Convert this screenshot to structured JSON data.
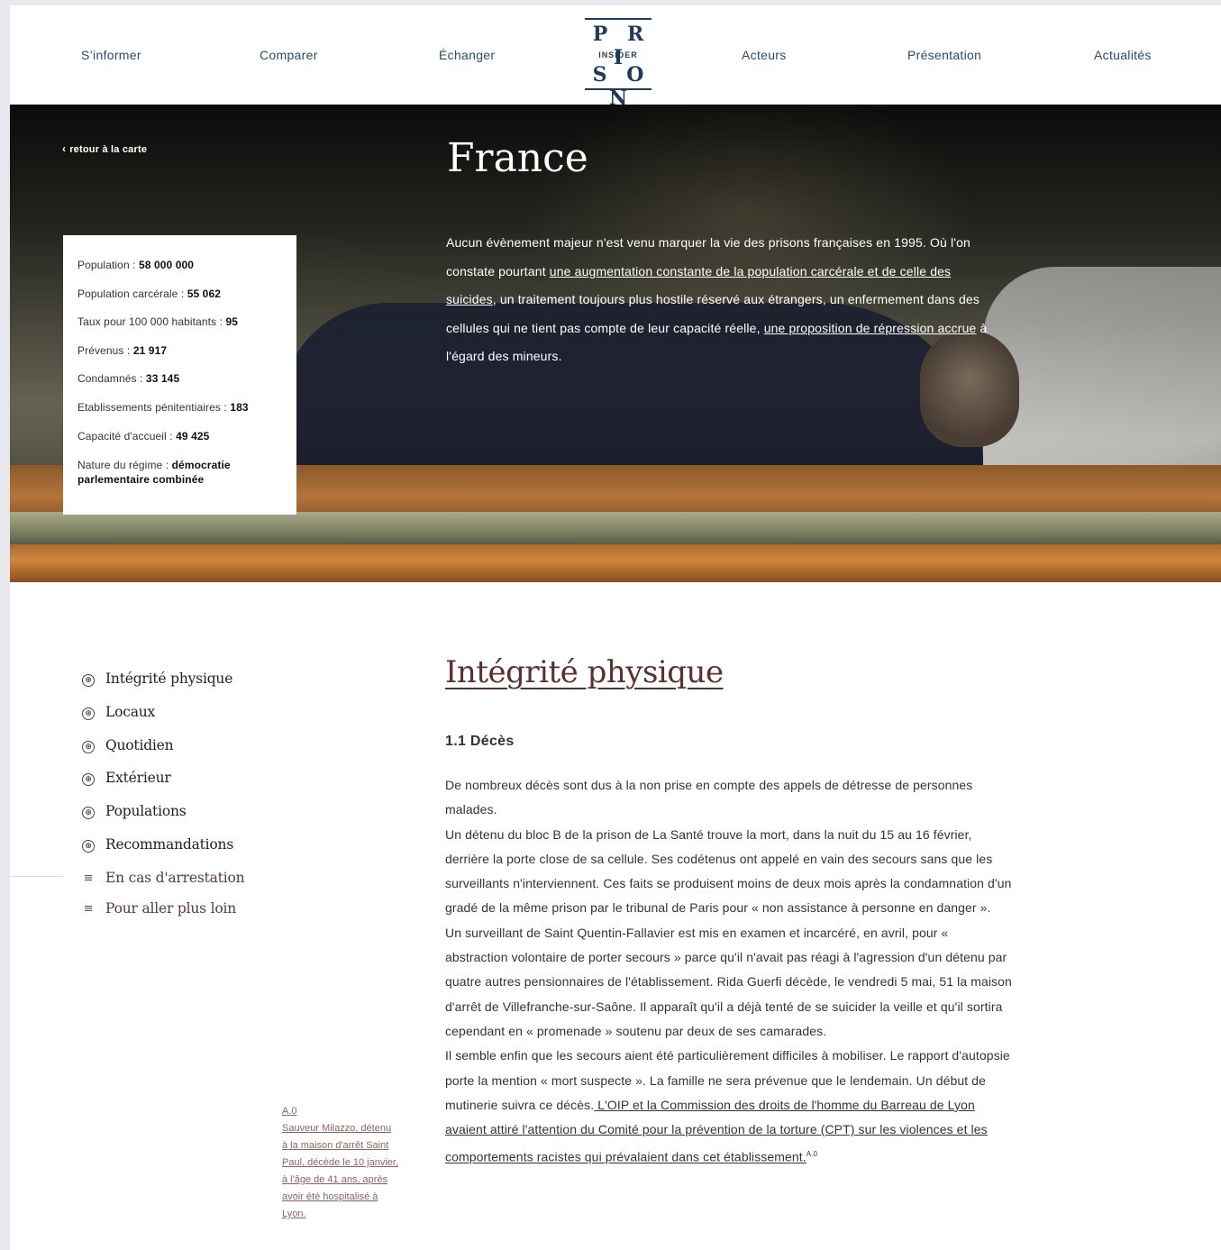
{
  "nav": {
    "items": [
      "S’informer",
      "Comparer",
      "Échanger",
      "Acteurs",
      "Présentation",
      "Actualités"
    ],
    "logo": {
      "top": "P R I",
      "middle": "INSIDER",
      "bottom": "S O N"
    }
  },
  "hero": {
    "back_label": "retour à la carte",
    "back_icon": "‹",
    "title": "France",
    "intro": {
      "p1": "Aucun évènement majeur n'est venu marquer la vie des prisons françaises en 1995. Où l'on constate pourtant ",
      "link1": "une augmentation constante de la population carcérale et de celle des suicides",
      "p2": ", un traitement toujours plus hostile réservé aux étrangers, un enfermement dans des cellules qui ne tient pas compte de leur capacité réelle, ",
      "link2": "une proposition de répression accrue",
      "p3": " à l'égard des mineurs."
    },
    "stats": [
      {
        "label": "Population : ",
        "value": "58 000 000"
      },
      {
        "label": "Population carcérale : ",
        "value": "55 062"
      },
      {
        "label": "Taux pour 100 000 habitants : ",
        "value": "95"
      },
      {
        "label": "Prévenus : ",
        "value": "21 917"
      },
      {
        "label": "Condamnés : ",
        "value": "33 145"
      },
      {
        "label": "Etablissements pénitentiaires : ",
        "value": "183"
      },
      {
        "label": "Capacité d'accueil : ",
        "value": "49 425"
      },
      {
        "label": "Nature du régime : ",
        "value": "démocratie parlementaire combinée"
      }
    ]
  },
  "sidebar": {
    "items": [
      {
        "label": "Intégrité physique",
        "icon": "⊕"
      },
      {
        "label": "Locaux",
        "icon": "⊕"
      },
      {
        "label": "Quotidien",
        "icon": "⊕"
      },
      {
        "label": "Extérieur",
        "icon": "⊕"
      },
      {
        "label": "Populations",
        "icon": "⊕"
      },
      {
        "label": "Recommandations",
        "icon": "⊕"
      },
      {
        "label": "En cas d'arrestation",
        "icon": "≡"
      },
      {
        "label": "Pour aller plus loin",
        "icon": "≡"
      }
    ]
  },
  "content": {
    "section_title": "Intégrité physique",
    "subheading": "1.1 Décès",
    "p1": "De nombreux décès sont dus à la non prise en compte des appels de détresse de personnes malades.",
    "p2": "Un détenu du bloc B de la prison de La Santé trouve la mort, dans la nuit du 15 au 16 février, derrière la porte close de sa cellule. Ses codétenus ont appelé en vain des secours sans que les surveillants n'interviennent. Ces faits se produisent moins de deux mois après la condamnation d'un gradé de la même prison par le tribunal de Paris pour « non assistance à personne en danger ».",
    "p3": "Un surveillant de Saint Quentin-Fallavier est mis en examen et incarcéré, en avril, pour « abstraction volontaire de porter secours » parce qu'il n'avait pas réagi à l'agression d'un détenu par quatre autres pensionnaires de l'établissement. Rida Guerfi décède, le vendredi 5 mai, 51 la maison d'arrêt de Villefranche-sur-Saône. Il apparaît qu'il a déjà tenté de se suicider la veille et qu'il sortira cependant en « promenade » soutenu par deux de ses camarades.",
    "p4": "Il semble enfin que les secours aient été particulièrement difficiles à mobiliser. Le rapport d'autopsie porte la mention « mort suspecte ». La famille ne sera prévenue que le lendemain. Un début de mutinerie suivra ce décès.",
    "p4_link": " L'OIP et la Commission des droits de l'homme du Barreau de Lyon avaient attiré l'attention du Comité pour la prévention de la torture (CPT) sur les violences et les comportements racistes qui prévalaient dans cet établissement.",
    "p4_ref": "A.0"
  },
  "note": {
    "number": "A.0",
    "text": "Sauveur Milazzo, détenu à la maison d'arrêt Saint Paul, décède le 10 janvier, à l'âge de 41 ans, après avoir été hospitalisé à Lyon."
  },
  "colors": {
    "nav_text": "#2c4a6a",
    "accent_title": "#5a3030",
    "note": "#8a6464"
  }
}
